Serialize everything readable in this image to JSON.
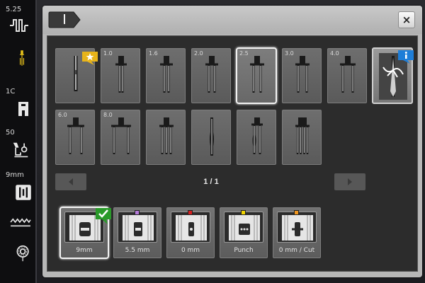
{
  "sidebar": {
    "items": [
      {
        "label": "5.25",
        "icon": "stitch-width-icon"
      },
      {
        "label": "",
        "icon": "needle-icon",
        "color": "#e8c21a"
      },
      {
        "label": "1C",
        "icon": "presser-foot-icon"
      },
      {
        "label": "50",
        "icon": "presser-foot-pressure-icon"
      },
      {
        "label": "9mm",
        "icon": "stitch-plate-icon"
      },
      {
        "label": "",
        "icon": "feed-dog-icon"
      },
      {
        "label": "",
        "icon": "bobbin-icon"
      }
    ]
  },
  "dialog": {
    "close_label": "×",
    "title_icon": "needle-tab-icon"
  },
  "needles": {
    "row1": [
      {
        "value": "",
        "type": "single",
        "favorite": true
      },
      {
        "value": "1.0",
        "type": "twin"
      },
      {
        "value": "1.6",
        "type": "twin"
      },
      {
        "value": "2.0",
        "type": "twin"
      },
      {
        "value": "2.5",
        "type": "twin",
        "selected": true
      },
      {
        "value": "3.0",
        "type": "twin"
      },
      {
        "value": "4.0",
        "type": "twin"
      },
      {
        "value": "",
        "type": "info",
        "info": true
      }
    ],
    "row2": [
      {
        "value": "6.0",
        "type": "twin"
      },
      {
        "value": "8.0",
        "type": "twin"
      },
      {
        "value": "",
        "type": "triple"
      },
      {
        "value": "",
        "type": "wing"
      },
      {
        "value": "",
        "type": "wing-twin"
      },
      {
        "value": "",
        "type": "quad"
      }
    ]
  },
  "pagination": {
    "indicator": "1 / 1",
    "prev_icon": "triangle-left-icon",
    "next_icon": "triangle-right-icon"
  },
  "feet": [
    {
      "label": "9mm",
      "selected": true,
      "check": true,
      "dot_color": ""
    },
    {
      "label": "5.5 mm",
      "selected": false,
      "dot_color": "#b47ad9"
    },
    {
      "label": "0 mm",
      "selected": false,
      "dot_color": "#d62020"
    },
    {
      "label": "Punch",
      "selected": false,
      "dot_color": "#f0d400"
    },
    {
      "label": "0 mm / Cut",
      "selected": false,
      "dot_color": "#f0961e"
    }
  ],
  "colors": {
    "accent_gold": "#e8b41a",
    "info_blue": "#1e7ed8",
    "check_green": "#2a9a2a"
  }
}
